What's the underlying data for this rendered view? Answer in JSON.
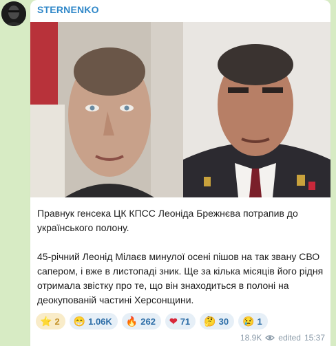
{
  "channel": {
    "name": "STERNENKO"
  },
  "post": {
    "paragraphs": [
      "Правнук генсека ЦК КПСС Леоніда Брежнєва потрапив до українського полону.",
      "45-річний Леонід Мілаєв минулої осені пішов на так звану СВО сапером, і вже в листопаді зник. Ще за кілька місяців його рідня отримала звістку про те, що він знаходиться в полоні на деокупованій частині Херсонщини."
    ]
  },
  "reactions": [
    {
      "icon": "star-icon",
      "emoji": "⭐",
      "count": "2"
    },
    {
      "icon": "grin-icon",
      "emoji": "😁",
      "count": "1.06K"
    },
    {
      "icon": "fire-icon",
      "emoji": "🔥",
      "count": "262"
    },
    {
      "icon": "heart-icon",
      "emoji": "❤",
      "count": "71"
    },
    {
      "icon": "thinking-icon",
      "emoji": "🤔",
      "count": "30"
    },
    {
      "icon": "sad-icon",
      "emoji": "😢",
      "count": "1"
    }
  ],
  "footer": {
    "views": "18.9K",
    "edited_label": "edited",
    "time": "15:37"
  },
  "colors": {
    "background": "#d7ebc4",
    "accent": "#2f87c8",
    "reaction_bg": "#e6eff7",
    "star_bg": "#f9ecc9"
  }
}
